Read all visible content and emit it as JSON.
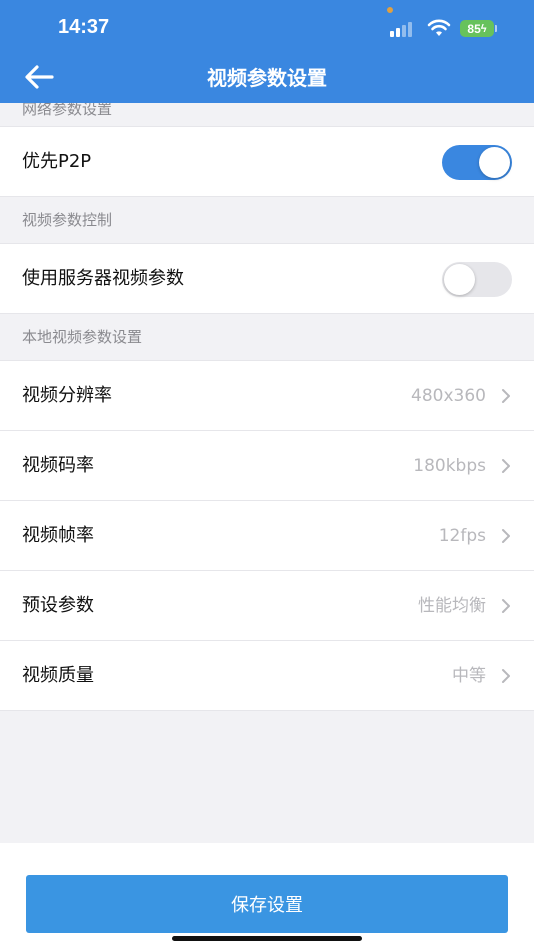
{
  "status_bar": {
    "time": "14:37",
    "battery": "85"
  },
  "nav": {
    "title": "视频参数设置"
  },
  "sections": {
    "network": {
      "header": "网络参数设置",
      "p2p": {
        "label": "优先P2P",
        "enabled": true
      }
    },
    "video_control": {
      "header": "视频参数控制",
      "server_params": {
        "label": "使用服务器视频参数",
        "enabled": false
      }
    },
    "local": {
      "header": "本地视频参数设置",
      "items": [
        {
          "label": "视频分辨率",
          "value": "480x360"
        },
        {
          "label": "视频码率",
          "value": "180kbps"
        },
        {
          "label": "视频帧率",
          "value": "12fps"
        },
        {
          "label": "预设参数",
          "value": "性能均衡"
        },
        {
          "label": "视频质量",
          "value": "中等"
        }
      ]
    }
  },
  "footer": {
    "save_label": "保存设置"
  },
  "colors": {
    "primary": "#3a87e0",
    "toggle_on": "#3a87e0",
    "toggle_off": "#e6e6ea",
    "battery": "#67c25c"
  }
}
